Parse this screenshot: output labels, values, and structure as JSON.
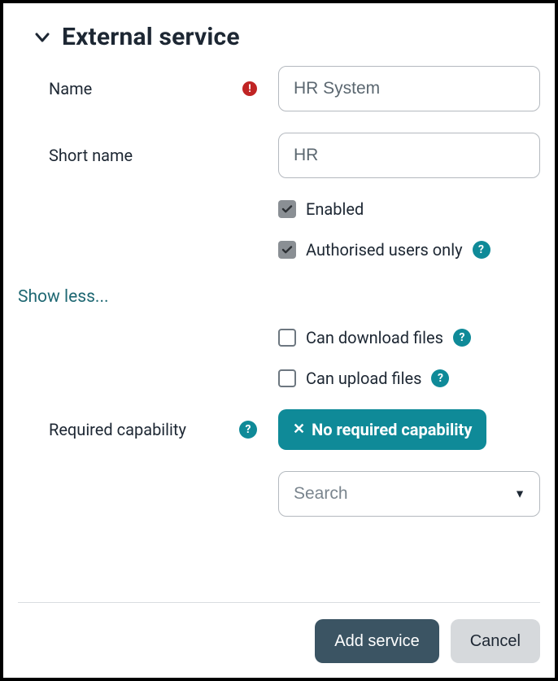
{
  "section": {
    "title": "External service"
  },
  "fields": {
    "name": {
      "label": "Name",
      "value": "HR System",
      "required": true
    },
    "shortname": {
      "label": "Short name",
      "value": "HR"
    },
    "enabled": {
      "label": "Enabled",
      "checked": true,
      "help": false
    },
    "authorised": {
      "label": "Authorised users only",
      "checked": true,
      "help": true
    },
    "download": {
      "label": "Can download files",
      "checked": false,
      "help": true
    },
    "upload": {
      "label": "Can upload files",
      "checked": false,
      "help": true
    },
    "capability": {
      "label": "Required capability",
      "help": true,
      "pill": "No required capability",
      "search_placeholder": "Search"
    }
  },
  "toggle": {
    "showless": "Show less..."
  },
  "buttons": {
    "submit": "Add service",
    "cancel": "Cancel"
  }
}
